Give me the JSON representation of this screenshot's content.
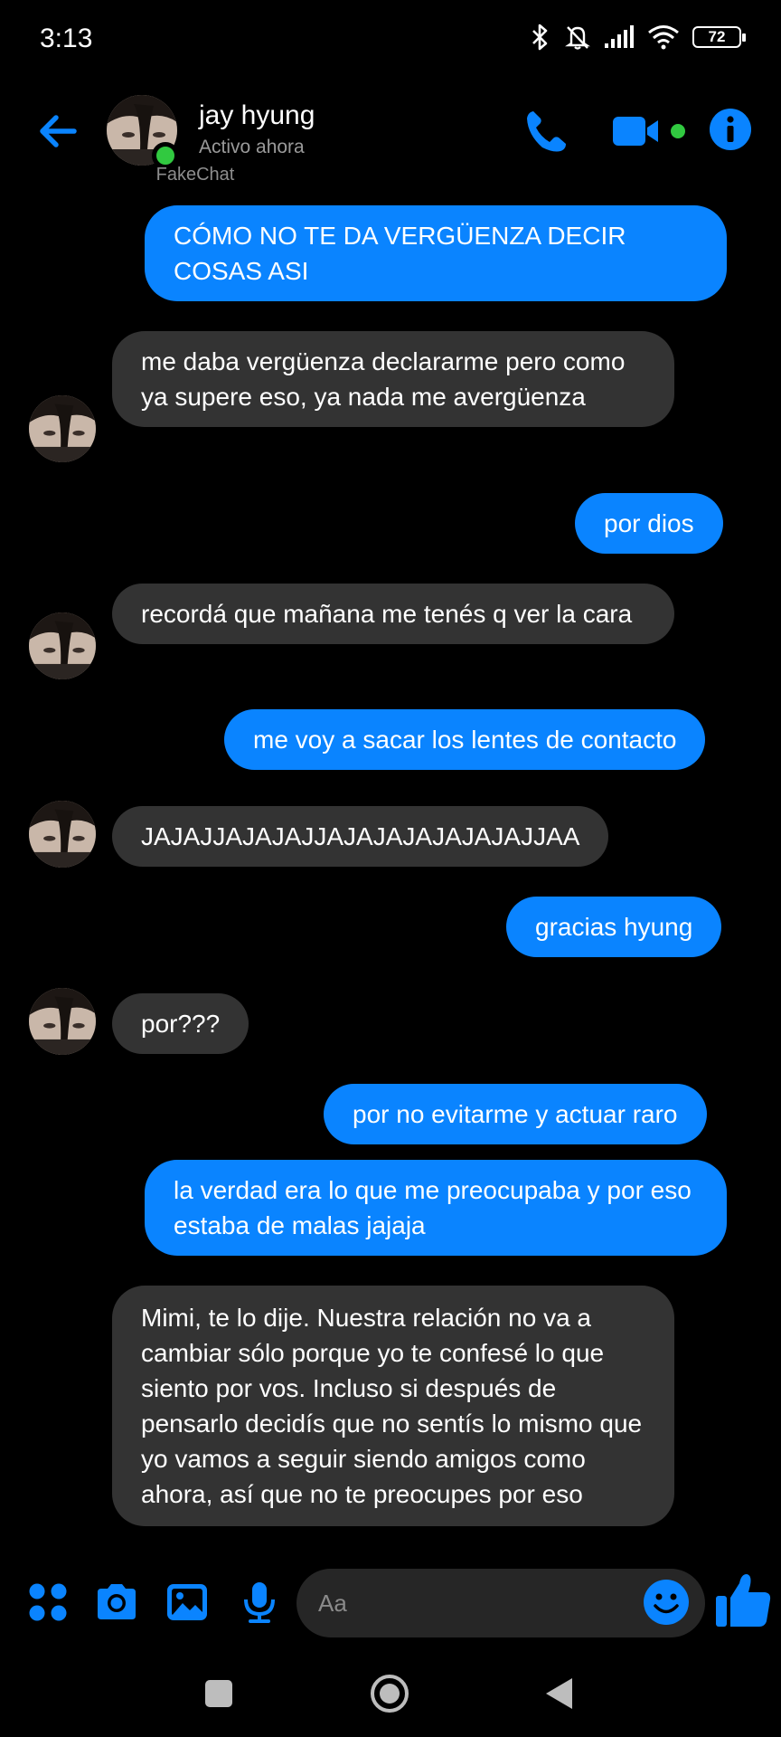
{
  "status_bar": {
    "time": "3:13",
    "battery": "72",
    "icons": [
      "bluetooth-icon",
      "bell-off-icon",
      "signal-icon",
      "wifi-icon",
      "battery-icon"
    ]
  },
  "header": {
    "contact_name": "jay hyung",
    "contact_status": "Activo ahora",
    "online": true
  },
  "watermark": "FakeChat",
  "messages": [
    {
      "from": "me",
      "text": "CÓMO NO TE DA VERGÜENZA DECIR COSAS ASI"
    },
    {
      "from": "them",
      "text": "me daba vergüenza declararme pero como ya supere eso, ya nada me avergüenza"
    },
    {
      "from": "me",
      "text": "por dios"
    },
    {
      "from": "them",
      "text": "recordá que mañana me tenés q ver la cara"
    },
    {
      "from": "me",
      "text": "me voy a sacar los lentes de contacto"
    },
    {
      "from": "them",
      "text": "JAJAJJAJAJAJJAJAJAJAJAJAJAJJAA"
    },
    {
      "from": "me",
      "text": "gracias hyung"
    },
    {
      "from": "them",
      "text": "por???"
    },
    {
      "from": "me",
      "text": "por no evitarme y actuar raro"
    },
    {
      "from": "me",
      "text": "la verdad era lo que me preocupaba y por eso estaba de malas jajaja"
    },
    {
      "from": "them",
      "text": "Mimi, te lo dije. Nuestra relación no va a cambiar sólo porque yo te confesé lo que siento por vos. Incluso si después de pensarlo decidís que no sentís lo mismo que yo vamos a seguir siendo amigos como ahora, así que no te preocupes por eso"
    }
  ],
  "composer": {
    "placeholder": "Aa",
    "icons": [
      "apps-icon",
      "camera-icon",
      "gallery-icon",
      "microphone-icon",
      "emoji-icon",
      "thumbs-up-icon"
    ]
  },
  "colors": {
    "accent": "#0a84ff",
    "incoming_bubble": "#333333",
    "online": "#31c940",
    "background": "#000000"
  }
}
